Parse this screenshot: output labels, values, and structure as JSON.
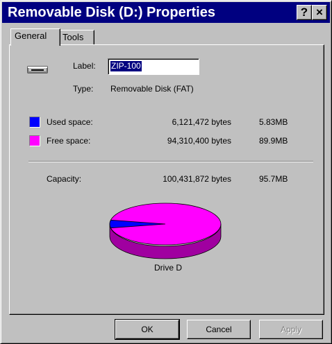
{
  "window": {
    "title": "Removable Disk (D:) Properties",
    "help_label": "?",
    "close_label": "×"
  },
  "tabs": [
    {
      "label": "General",
      "active": true
    },
    {
      "label": "Tools",
      "active": false
    }
  ],
  "general": {
    "label_caption": "Label:",
    "label_value": "ZIP-100",
    "type_caption": "Type:",
    "type_value": "Removable Disk (FAT)",
    "used": {
      "caption": "Used space:",
      "bytes": "6,121,472 bytes",
      "size": "5.83MB",
      "color": "#0000ff",
      "fraction": 0.061
    },
    "free": {
      "caption": "Free space:",
      "bytes": "94,310,400 bytes",
      "size": "89.9MB",
      "color": "#ff00ff",
      "fraction": 0.939
    },
    "capacity": {
      "caption": "Capacity:",
      "bytes": "100,431,872 bytes",
      "size": "95.7MB"
    },
    "pie_caption": "Drive D"
  },
  "buttons": {
    "ok": "OK",
    "cancel": "Cancel",
    "apply": "Apply"
  }
}
